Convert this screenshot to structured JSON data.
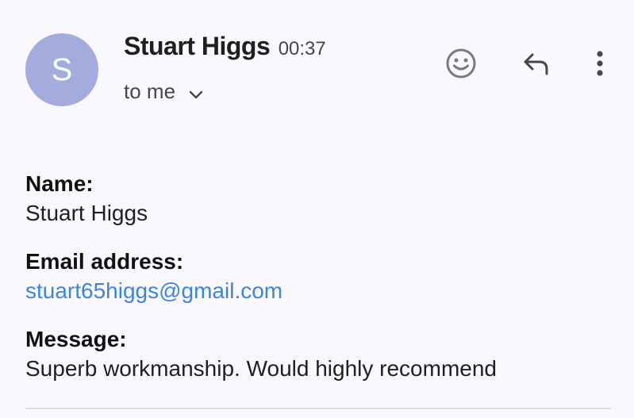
{
  "email": {
    "sender": {
      "initial": "S",
      "name": "Stuart Higgs",
      "time": "00:37",
      "avatar_color": "#a4acdd"
    },
    "recipient_label": "to me",
    "actions": {
      "emoji_icon": "emoji-react-icon",
      "reply_icon": "reply-icon",
      "more_icon": "more-vertical-icon"
    },
    "fields": {
      "name_label": "Name:",
      "name_value": "Stuart Higgs",
      "email_label": "Email address:",
      "email_value": "stuart65higgs@gmail.com",
      "message_label": "Message:",
      "message_value": "Superb workmanship. Would highly recommend"
    },
    "colors": {
      "background": "#fbf8fd",
      "link": "#3b86db"
    }
  }
}
